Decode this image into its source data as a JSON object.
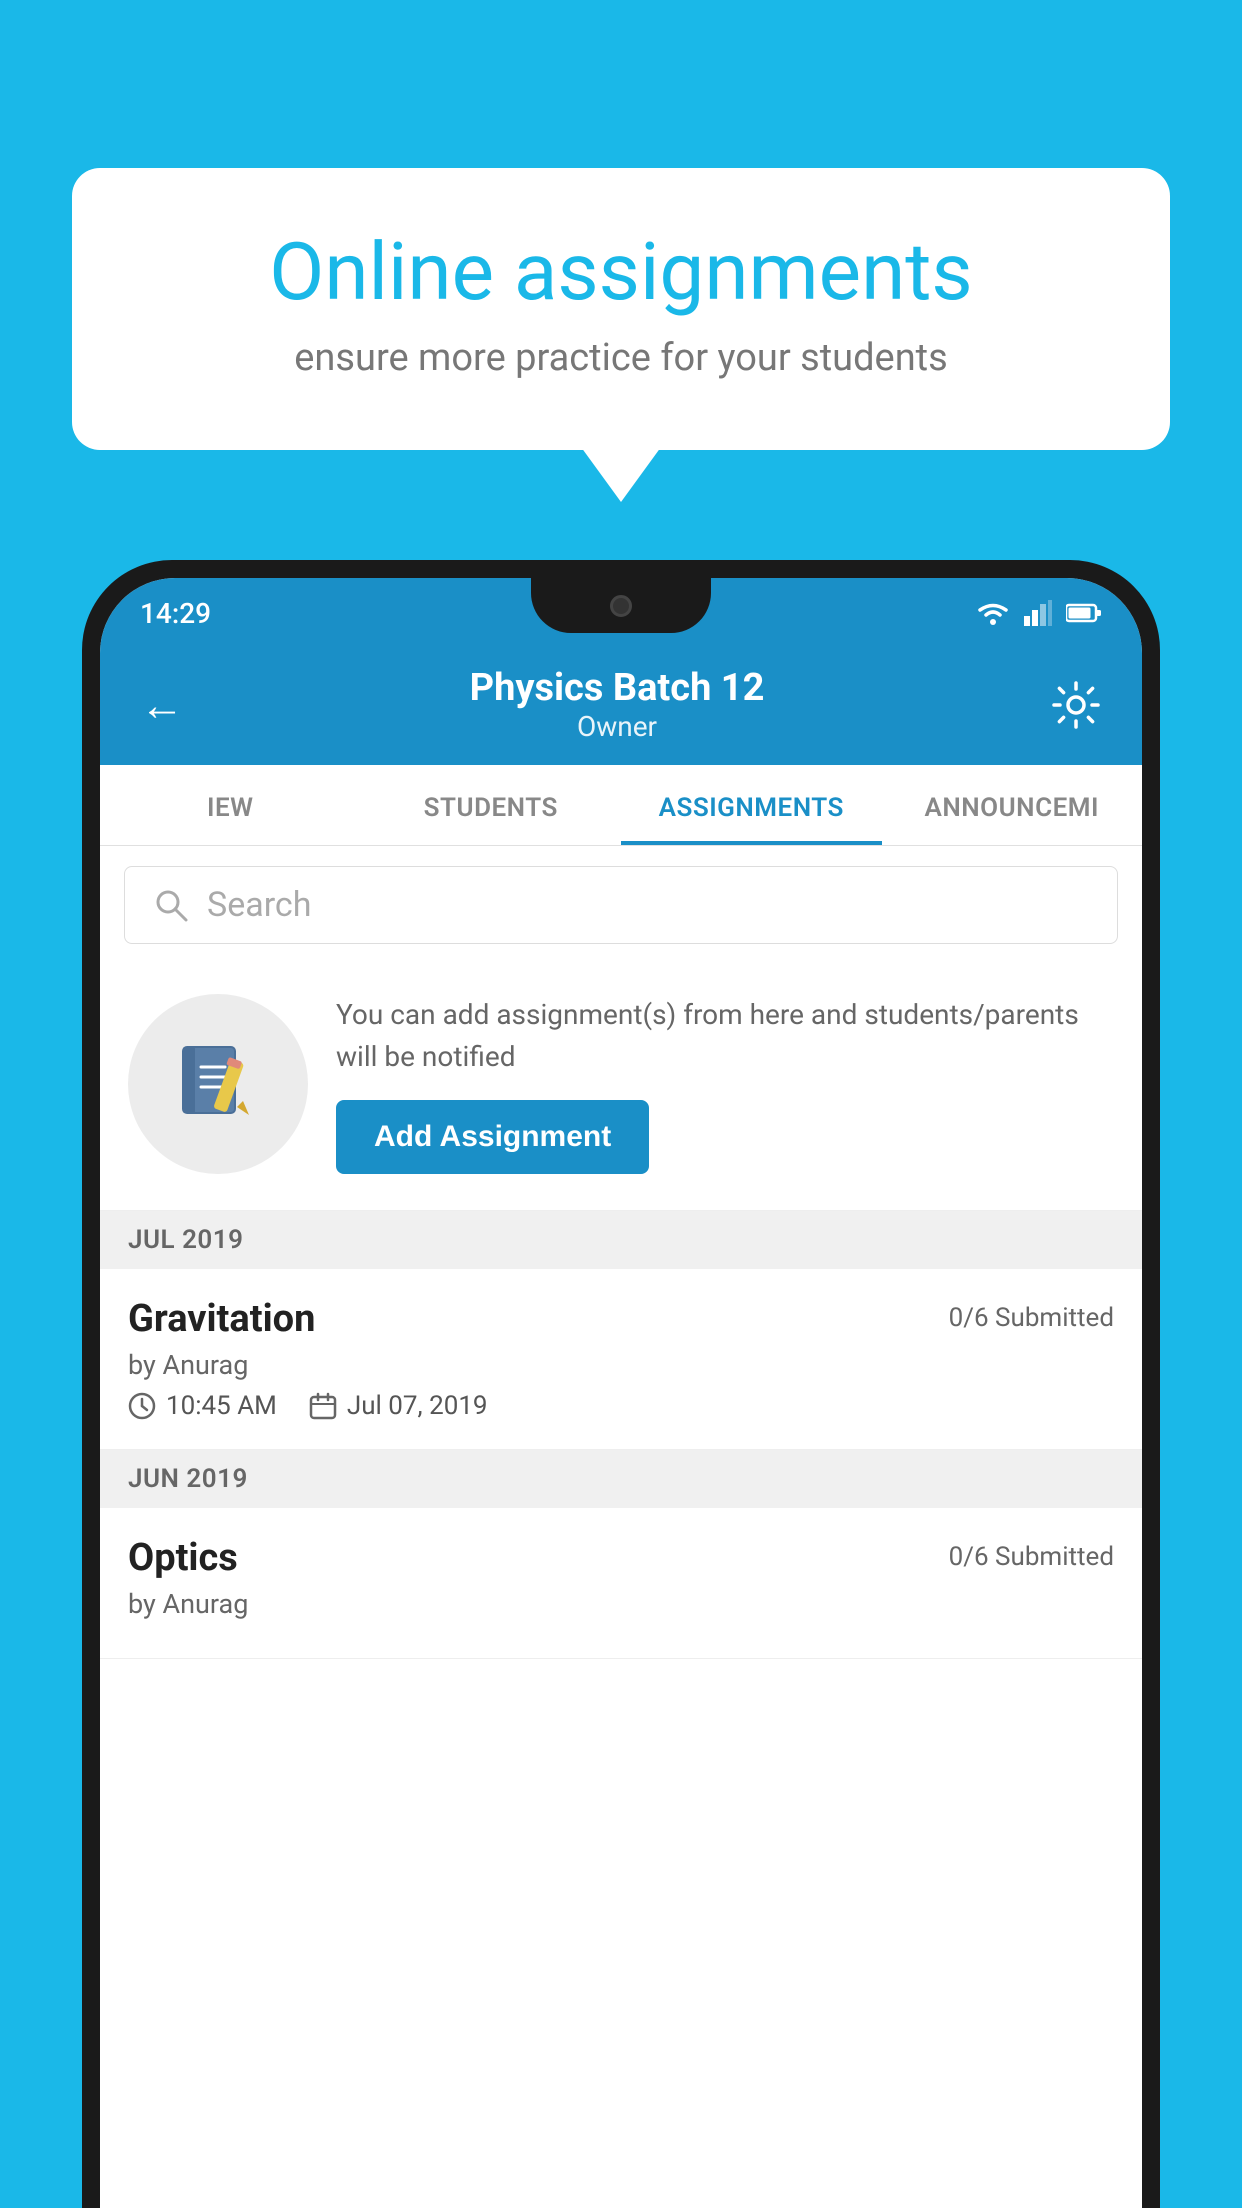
{
  "background_color": "#1ab8e8",
  "speech_bubble": {
    "title": "Online assignments",
    "subtitle": "ensure more practice for your students"
  },
  "status_bar": {
    "time": "14:29"
  },
  "header": {
    "title": "Physics Batch 12",
    "subtitle": "Owner",
    "back_label": "←"
  },
  "tabs": [
    {
      "label": "IEW",
      "active": false
    },
    {
      "label": "STUDENTS",
      "active": false
    },
    {
      "label": "ASSIGNMENTS",
      "active": true
    },
    {
      "label": "ANNOUNCEMI",
      "active": false
    }
  ],
  "search": {
    "placeholder": "Search"
  },
  "empty_state": {
    "description": "You can add assignment(s) from here and students/parents will be notified",
    "button_label": "Add Assignment"
  },
  "sections": [
    {
      "month": "JUL 2019",
      "assignments": [
        {
          "name": "Gravitation",
          "submitted": "0/6 Submitted",
          "by": "by Anurag",
          "time": "10:45 AM",
          "date": "Jul 07, 2019"
        }
      ]
    },
    {
      "month": "JUN 2019",
      "assignments": [
        {
          "name": "Optics",
          "submitted": "0/6 Submitted",
          "by": "by Anurag",
          "time": "",
          "date": ""
        }
      ]
    }
  ]
}
